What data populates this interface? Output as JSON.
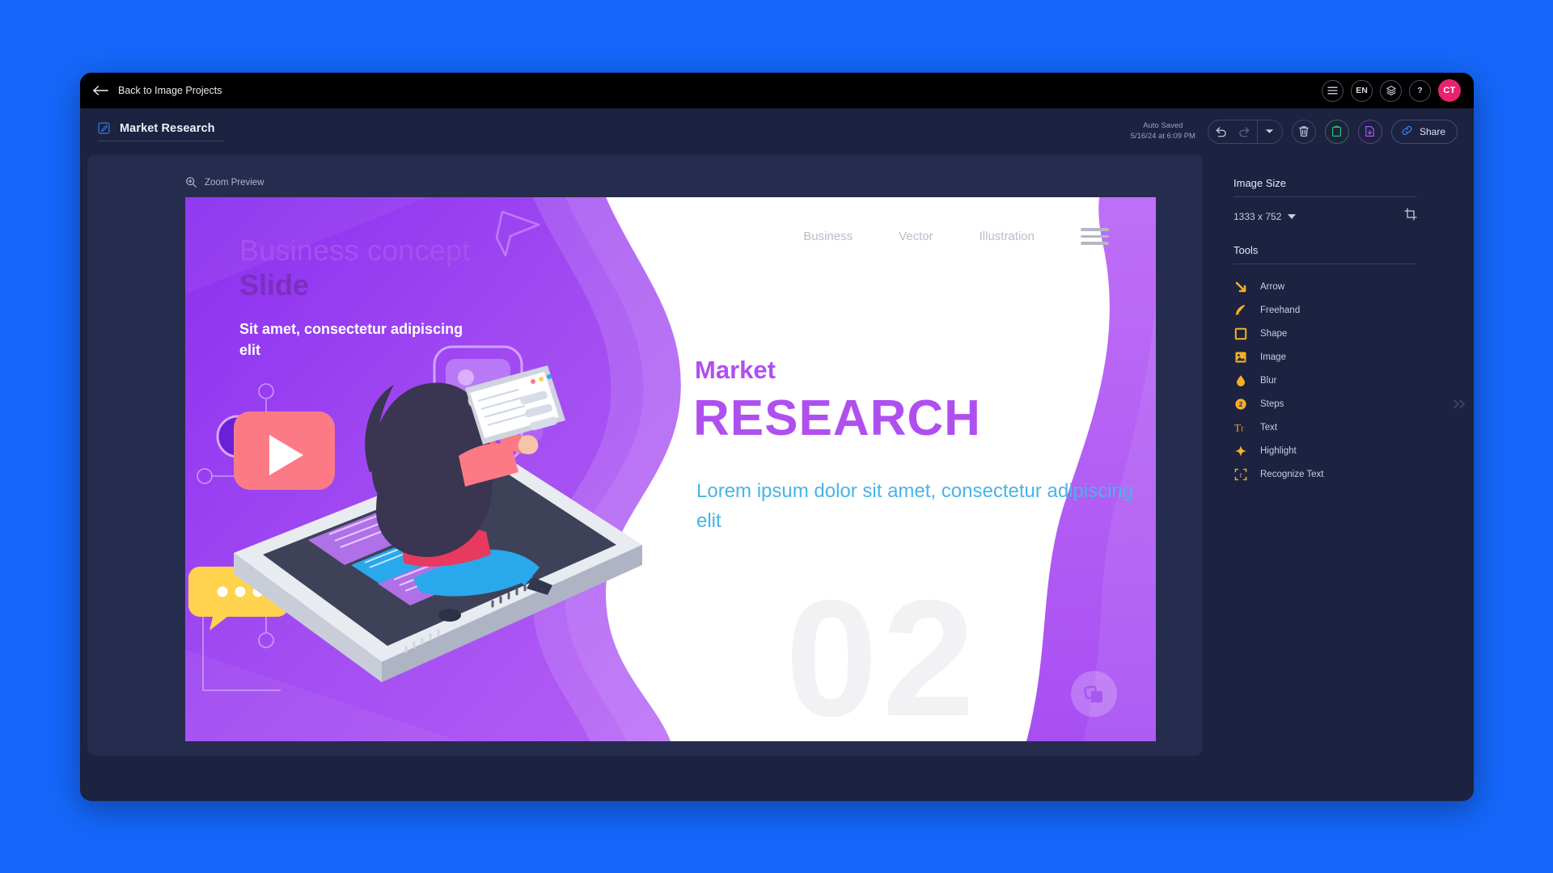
{
  "topbar": {
    "back_label": "Back to Image Projects",
    "back_icon": "arrow-left-icon",
    "menu_icon": "hamburger-menu-icon",
    "language": "EN",
    "layers_icon": "layers-icon",
    "help_label": "?",
    "avatar_initials": "CT"
  },
  "titlebar": {
    "edit_icon": "edit-square-icon",
    "project_title": "Market Research",
    "autosave_label": "Auto Saved",
    "autosave_timestamp": "5/16/24 at 6:09 PM",
    "undo_icon": "undo-icon",
    "redo_icon": "redo-icon",
    "history_caret_icon": "chevron-down-icon",
    "delete_icon": "trash-icon",
    "copy_icon": "clipboard-icon",
    "download_icon": "download-file-icon",
    "share_icon": "link-icon",
    "share_label": "Share"
  },
  "canvas": {
    "zoom_preview_label": "Zoom Preview",
    "zoom_preview_icon": "magnifier-plus-icon",
    "collapse_icon": "double-chevron-right-icon"
  },
  "slide": {
    "nav": [
      {
        "label": "Business"
      },
      {
        "label": "Vector"
      },
      {
        "label": "Illustration"
      }
    ],
    "nav_menu_icon": "hamburger-menu-icon",
    "kicker": "Business concept",
    "kicker_bold": "Slide",
    "subtitle": "Sit amet, consectetur adipiscing elit",
    "title_small": "Market",
    "title_big": "RESEARCH",
    "body": "Lorem ipsum dolor sit amet, consectetur adipiscing elit",
    "watermark": "02",
    "corner_icon": "copy-squares-icon",
    "illustration": "woman-sitting-on-smartphone-with-tablet"
  },
  "sidebar": {
    "image_size_heading": "Image Size",
    "image_size_value": "1333 x 752",
    "crop_icon": "crop-icon",
    "tools_heading": "Tools",
    "tools": [
      {
        "label": "Arrow",
        "icon": "arrow-tool-icon"
      },
      {
        "label": "Freehand",
        "icon": "pen-tool-icon"
      },
      {
        "label": "Shape",
        "icon": "square-tool-icon"
      },
      {
        "label": "Image",
        "icon": "image-tool-icon"
      },
      {
        "label": "Blur",
        "icon": "drop-tool-icon"
      },
      {
        "label": "Steps",
        "icon": "numbered-step-icon"
      },
      {
        "label": "Text",
        "icon": "text-tool-icon"
      },
      {
        "label": "Highlight",
        "icon": "sparkle-tool-icon"
      },
      {
        "label": "Recognize Text",
        "icon": "ocr-tool-icon"
      }
    ]
  },
  "colors": {
    "page_background": "#1567fb",
    "window_background": "#1c2240",
    "topbar_background": "#000000",
    "canvas_background": "#262c4e",
    "accent_tool": "#f5b024",
    "avatar": "#e8236e",
    "slide_purple": "#9333ea",
    "slide_title": "#b04ff0",
    "slide_body_text": "#49b3e8"
  }
}
